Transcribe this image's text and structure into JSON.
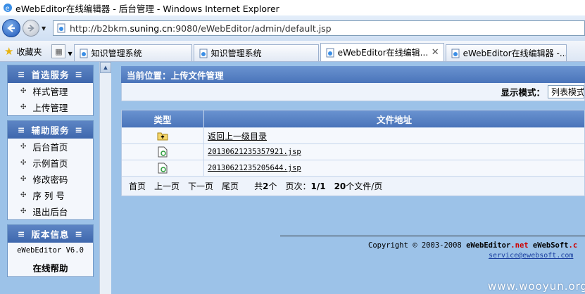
{
  "window": {
    "title": "eWebEditor在线编辑器 - 后台管理 - Windows Internet Explorer"
  },
  "address": {
    "prefix": "http://b2bkm.",
    "domain": "suning.cn",
    "suffix": ":9080/eWebEditor/admin/default.jsp"
  },
  "favorites": {
    "label": "收藏夹"
  },
  "tabs": [
    {
      "label": "知识管理系统"
    },
    {
      "label": "知识管理系统"
    },
    {
      "label": "eWebEditor在线编辑..."
    },
    {
      "label": "eWebEditor在线编辑器 -..."
    }
  ],
  "sidebar": {
    "sections": [
      {
        "title": "首选服务",
        "items": [
          {
            "label": "样式管理"
          },
          {
            "label": "上传管理"
          }
        ]
      },
      {
        "title": "辅助服务",
        "items": [
          {
            "label": "后台首页"
          },
          {
            "label": "示例首页"
          },
          {
            "label": "修改密码"
          },
          {
            "label": "序 列 号"
          },
          {
            "label": "退出后台"
          }
        ]
      }
    ],
    "version": {
      "title": "版本信息",
      "version_text": "eWebEditor V6.0",
      "help": "在线帮助"
    }
  },
  "main": {
    "breadcrumb": "当前位置：上传文件管理",
    "display_mode_label": "显示模式：",
    "display_mode_value": "列表模式",
    "table": {
      "headers": [
        "类型",
        "文件地址"
      ],
      "rows": [
        {
          "icon": "folder-up-icon",
          "name": "返回上一级目录"
        },
        {
          "icon": "jsp-file-icon",
          "name": "20130621235357921.jsp"
        },
        {
          "icon": "jsp-file-icon",
          "name": "20130621235205644.jsp"
        }
      ]
    },
    "pager": {
      "first": "首页",
      "prev": "上一页",
      "next": "下一页",
      "last": "尾页",
      "total_prefix": "共",
      "total": "2",
      "total_suffix": "个",
      "page_prefix": "页次：",
      "page": "1/1",
      "per_page": "20",
      "per_page_suffix": "个文件/页"
    }
  },
  "footer": {
    "copyright_prefix": "Copyright © 2003-2008 ",
    "brand1": "eWebEditor",
    "brand1_tld": ".net",
    "brand2": "eWebSoft",
    "brand2_tld": ".c",
    "email": "service@ewebsoft.com"
  },
  "watermark": "www.wooyun.org"
}
